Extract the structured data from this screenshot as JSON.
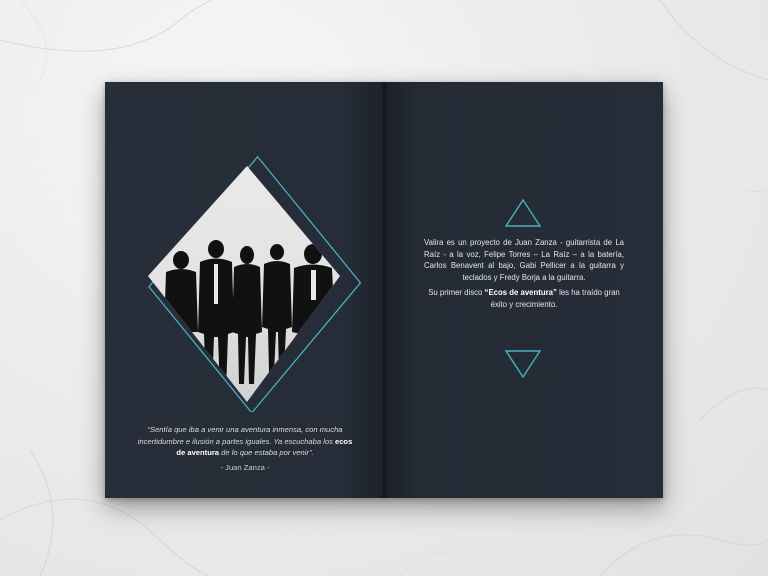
{
  "quote": {
    "part1": "“Sentía que iba a venir una aventura inmensa, con mucha incertidumbre e ilusión a partes iguales. Ya escuchaba los ",
    "highlight": "ecos de aventura",
    "part2": " de lo que estaba por venir”.",
    "author": "- Juan Zanza -"
  },
  "bio": {
    "paragraph1": "Valira es un proyecto de Juan Zanza - guitarrista de La Raíz - a la voz, Felipe Torres – La Raíz – a la batería, Carlos Benavent al bajo, Gabi Pellicer a la guitarra y teclados y Fredy Borja a la guitarra.",
    "p2_before": "Su primer disco ",
    "p2_highlight": "“Ecos de aventura”",
    "p2_after": " les ha traído gran éxito y crecimiento."
  },
  "colors": {
    "page": "#262d38",
    "accent": "#46b3c3",
    "background": "#ececec"
  }
}
